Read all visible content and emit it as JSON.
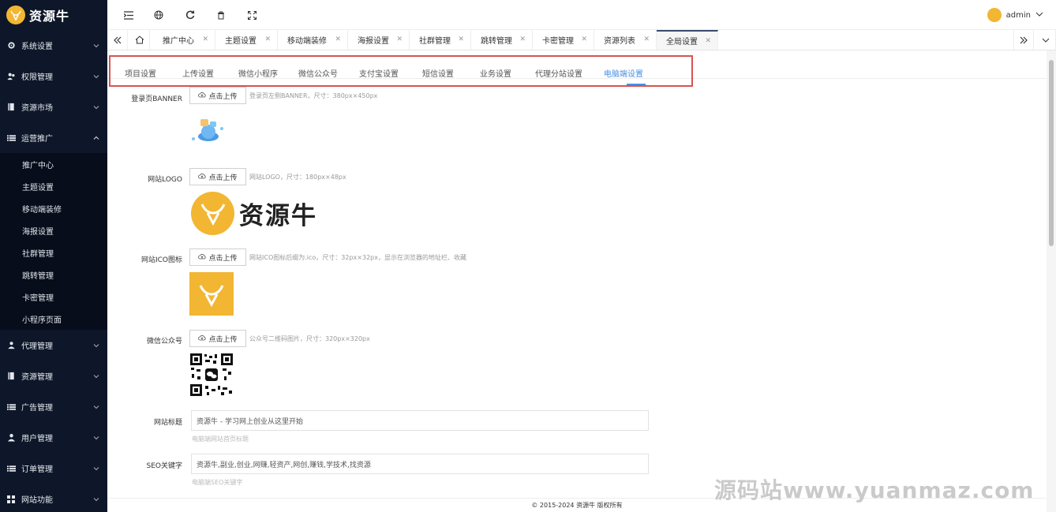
{
  "brand": {
    "name": "资源牛",
    "color": "#f2b632"
  },
  "sidebar": {
    "menus": [
      {
        "label": "系统设置",
        "icon": "gear-icon"
      },
      {
        "label": "权限管理",
        "icon": "users-icon"
      },
      {
        "label": "资源市场",
        "icon": "book-icon"
      },
      {
        "label": "运营推广",
        "icon": "list-icon"
      }
    ],
    "submenu": [
      "推广中心",
      "主题设置",
      "移动端装修",
      "海报设置",
      "社群管理",
      "跳转管理",
      "卡密管理",
      "小程序页面"
    ],
    "menus_after": [
      {
        "label": "代理管理",
        "icon": "users-icon"
      },
      {
        "label": "资源管理",
        "icon": "book-icon"
      },
      {
        "label": "广告管理",
        "icon": "list-icon"
      },
      {
        "label": "用户管理",
        "icon": "user-icon"
      },
      {
        "label": "订单管理",
        "icon": "list-icon"
      },
      {
        "label": "网站功能",
        "icon": "grid-icon"
      }
    ]
  },
  "topbar": {
    "user_name": "admin"
  },
  "tabs": [
    "推广中心",
    "主题设置",
    "移动端装修",
    "海报设置",
    "社群管理",
    "跳转管理",
    "卡密管理",
    "资源列表",
    "全局设置"
  ],
  "subtabs": [
    "项目设置",
    "上传设置",
    "微信小程序",
    "微信公众号",
    "支付宝设置",
    "短信设置",
    "业务设置",
    "代理分站设置",
    "电脑端设置"
  ],
  "form": {
    "upload_label": "点击上传",
    "banner": {
      "label": "登录页BANNER",
      "hint": "登录页左侧BANNER，尺寸：380px×450px"
    },
    "logo": {
      "label": "网站LOGO",
      "hint": "网站LOGO，尺寸：180px×48px"
    },
    "ico": {
      "label": "网站ICO图标",
      "hint": "网站ICO图标后缀为.ico，尺寸：32px×32px，显示在浏览器的地址栏、收藏"
    },
    "wechat": {
      "label": "微信公众号",
      "hint": "公众号二维码图片，尺寸：320px×320px"
    },
    "site_title": {
      "label": "网站标题",
      "value": "资源牛 - 学习网上创业从这里开始",
      "hint": "电脑端网站首页标题"
    },
    "seo_keywords": {
      "label": "SEO关键字",
      "value": "资源牛,副业,创业,网赚,轻资产,网创,赚钱,学技术,找资源",
      "hint": "电脑端SEO关键字"
    }
  },
  "logo_text": "资源牛",
  "footer": "© 2015-2024 资源牛 版权所有",
  "watermark": "源码站www.yuanmaz.com"
}
